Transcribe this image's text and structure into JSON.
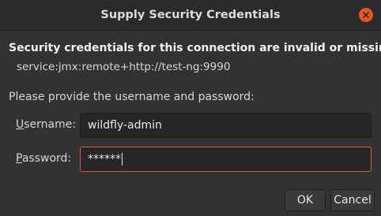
{
  "dialog": {
    "title": "Supply Security Credentials",
    "heading": "Security credentials for this connection are invalid or missing:",
    "service": "service:jmx:remote+http://test-ng:9990",
    "prompt": "Please provide the username and password:"
  },
  "fields": {
    "username_label_mnemonic": "U",
    "username_label_rest": "sername:",
    "username_value": "wildfly-admin",
    "password_label_mnemonic": "P",
    "password_label_rest": "assword:",
    "password_value": "******"
  },
  "buttons": {
    "ok": "OK",
    "cancel": "Cancel"
  },
  "colors": {
    "close_button": "#e95420",
    "focus_border": "#d9622c"
  },
  "icons": {
    "close": "close-icon"
  }
}
